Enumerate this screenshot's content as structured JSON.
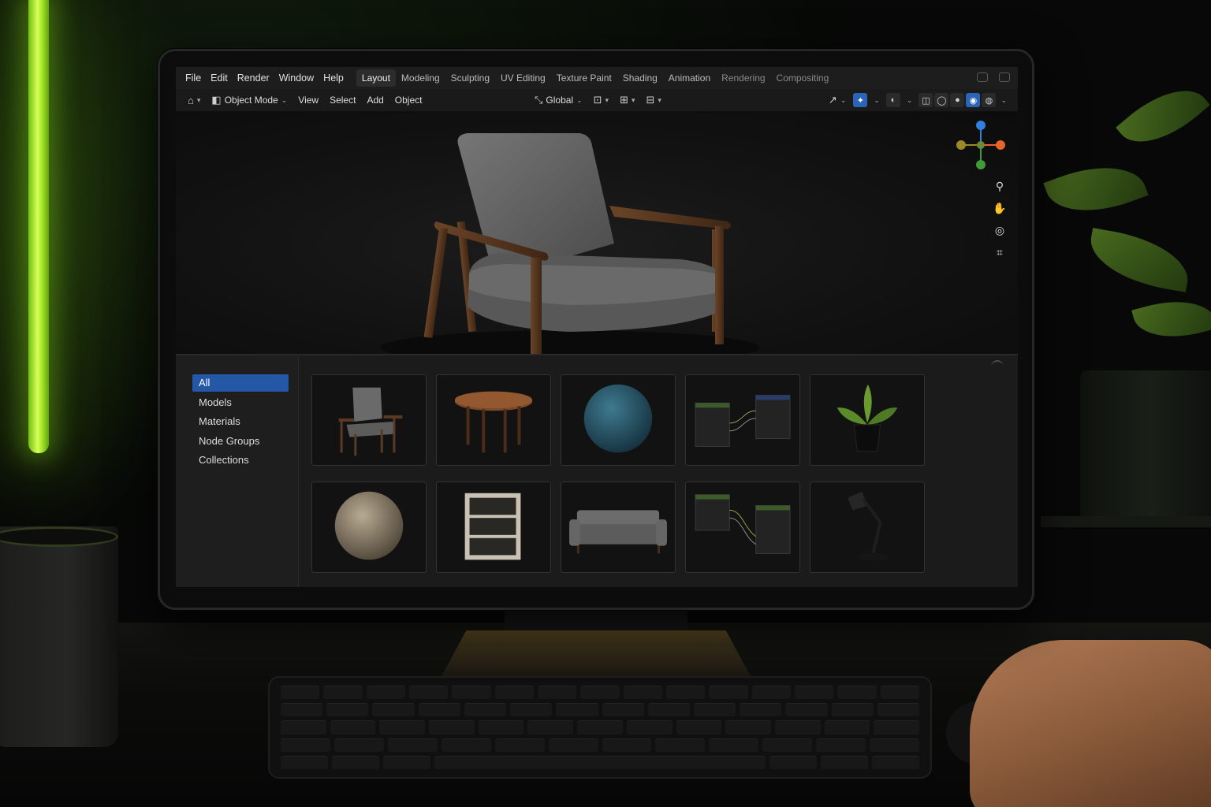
{
  "topbar": {
    "menu": [
      "File",
      "Edit",
      "Render",
      "Window",
      "Help"
    ],
    "workspaces": [
      "Layout",
      "Modeling",
      "Sculpting",
      "UV Editing",
      "Texture Paint",
      "Shading",
      "Animation",
      "Rendering",
      "Compositing"
    ],
    "active_workspace": "Layout"
  },
  "header": {
    "mode": "Object Mode",
    "menus": [
      "View",
      "Select",
      "Add",
      "Object"
    ],
    "orientation": "Global"
  },
  "viewport": {
    "subject": "armchair-model",
    "gizmo_axes": [
      "z-axis",
      "x-axis",
      "y-axis"
    ]
  },
  "asset_browser": {
    "categories": [
      "All",
      "Models",
      "Materials",
      "Node Groups",
      "Collections"
    ],
    "active_category": "All",
    "assets": [
      "armchair",
      "round-table",
      "blue-sphere-material",
      "node-group",
      "potted-plant",
      "beige-sphere-material",
      "bookshelf",
      "sofa",
      "node-group",
      "desk-lamp"
    ]
  },
  "colors": {
    "accent_blue": "#2458a6",
    "neon_green": "#b4f032",
    "gizmo_x": "#e8642a",
    "gizmo_y": "#3f9a3a",
    "gizmo_z": "#2f7fdc"
  }
}
